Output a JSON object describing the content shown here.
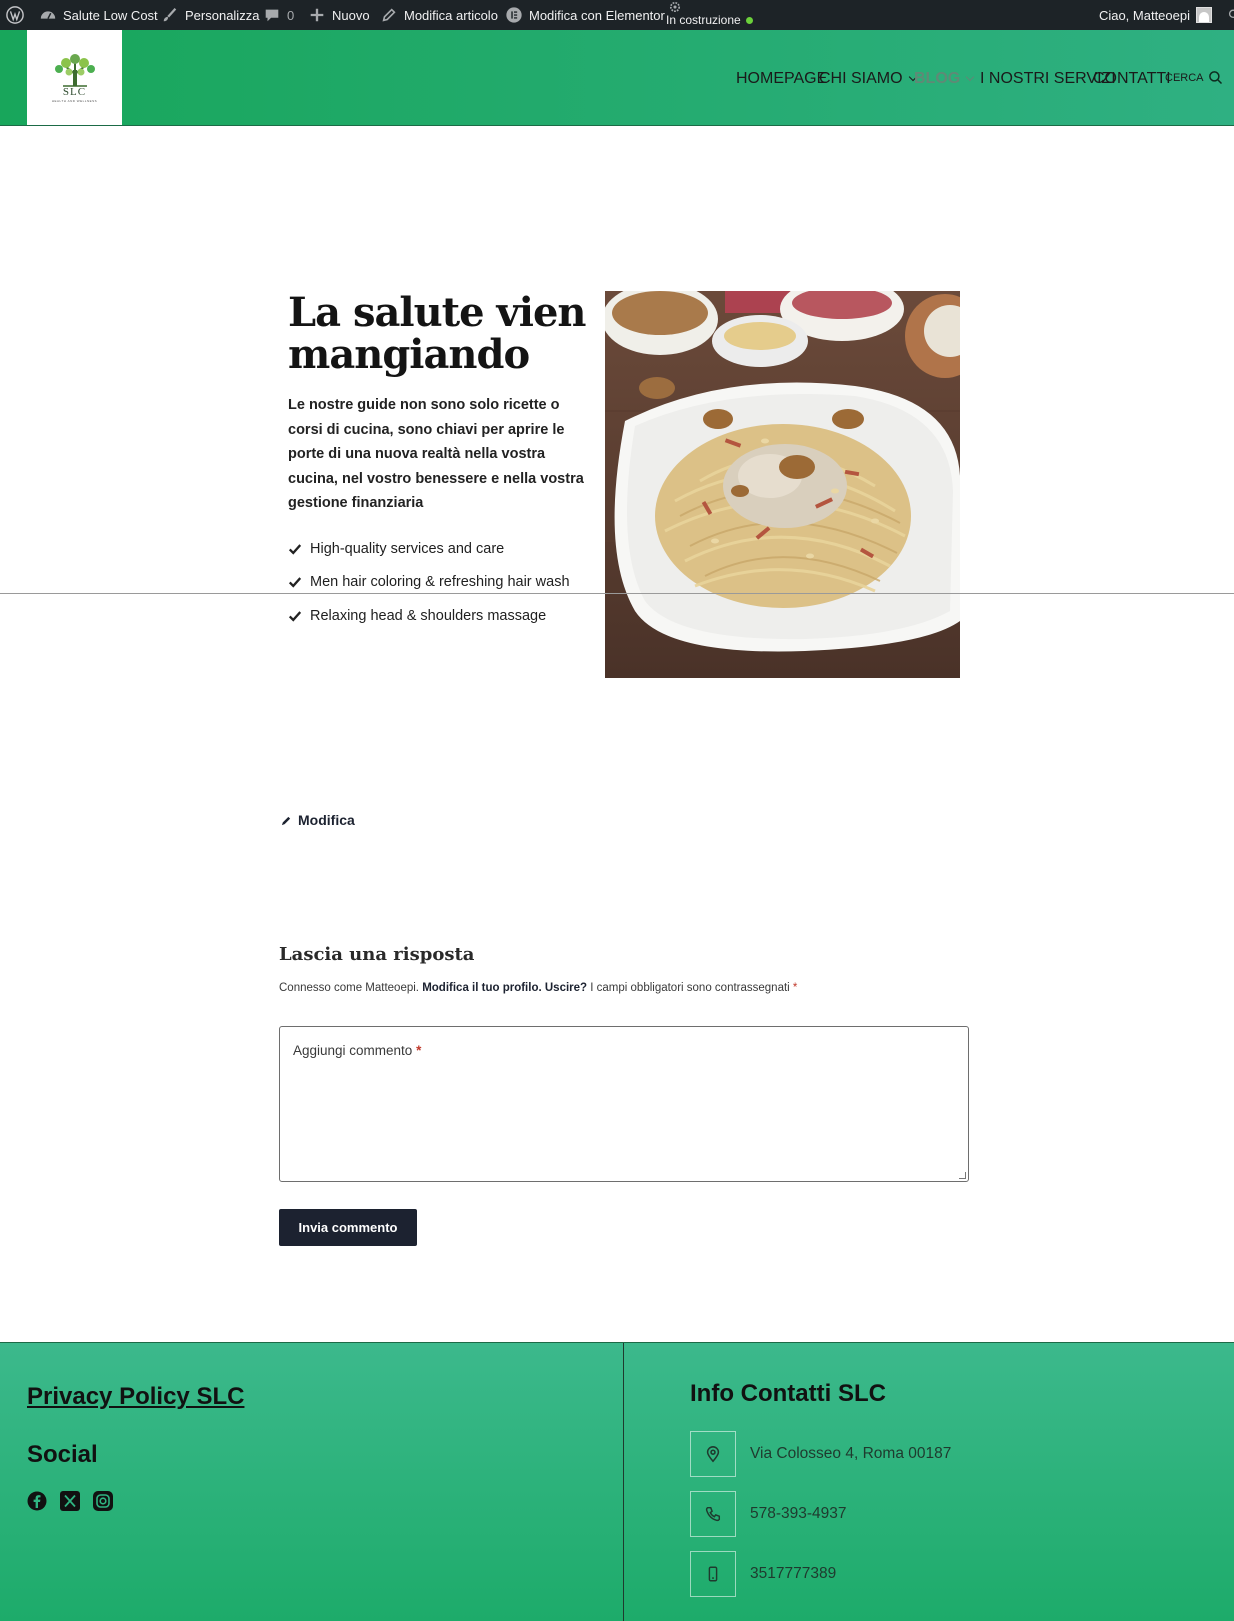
{
  "adminbar": {
    "site_name": "Salute Low Cost",
    "customize": "Personalizza",
    "comments_count": "0",
    "new": "Nuovo",
    "edit_post": "Modifica articolo",
    "edit_elementor": "Modifica con Elementor",
    "status": "In costruzione",
    "greeting": "Ciao, Matteoepi"
  },
  "header": {
    "logo_text": "SLC",
    "logo_subtext": "HEALTH AND WELLNESS",
    "nav": [
      {
        "label": "HOMEPAGE"
      },
      {
        "label": "CHI SIAMO"
      },
      {
        "label": "BLOG"
      },
      {
        "label": "I NOSTRI SERVIZI"
      },
      {
        "label": "CONTATTI"
      },
      {
        "label": "CERCA"
      }
    ]
  },
  "hero": {
    "title": "La salute vien mangiando",
    "lead": "Le nostre guide non sono solo ricette o corsi di cucina, sono chiavi per aprire le porte di una nuova realtà nella vostra cucina, nel vostro benessere e nella vostra gestione finanziaria",
    "features": [
      "High-quality services and care",
      "Men hair coloring & refreshing hair wash",
      "Relaxing head & shoulders massage"
    ]
  },
  "edit_link": "Modifica",
  "comments": {
    "title": "Lascia una risposta",
    "logged_in_prefix": "Connesso come Matteoepi.",
    "edit_profile": "Modifica il tuo profilo.",
    "logout": "Uscire?",
    "required_note": "I campi obbligatori sono contrassegnati",
    "required_mark": "*",
    "textarea_label": "Aggiungi commento",
    "submit": "Invia commento"
  },
  "footer": {
    "privacy": "Privacy Policy SLC",
    "social_title": "Social",
    "social_icons": [
      "facebook-icon",
      "x-icon",
      "instagram-icon"
    ],
    "info_title": "Info Contatti SLC",
    "address": "Via Colosseo 4, Roma 00187",
    "phone": "578-393-4937",
    "mobile": "3517777389"
  },
  "colors": {
    "adminbar": "#1d2327",
    "header_green_start": "#18a65b",
    "header_green_end": "#2fb082",
    "button_dark": "#1c2230",
    "footer_green": "#2fb582"
  }
}
